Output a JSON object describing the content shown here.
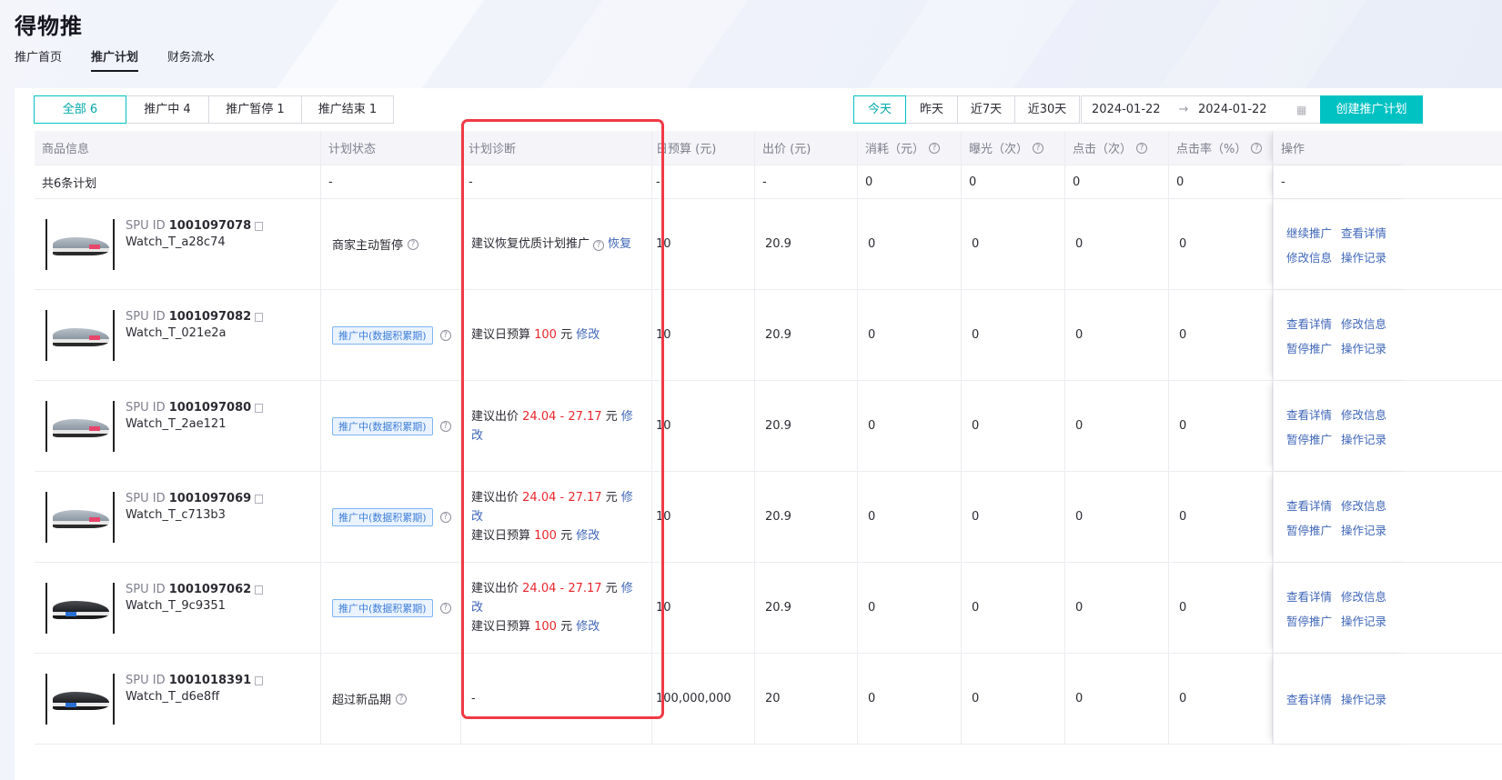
{
  "app": {
    "title": "得物推"
  },
  "nav": {
    "tabs": [
      "推广首页",
      "推广计划",
      "财务流水"
    ],
    "active_index": 1
  },
  "status_filter": {
    "options": [
      "全部 6",
      "推广中 4",
      "推广暂停 1",
      "推广结束 1"
    ],
    "active_index": 0
  },
  "date_filter": {
    "options": [
      "今天",
      "昨天",
      "近7天",
      "近30天"
    ],
    "active_index": 0,
    "start": "2024-01-22",
    "end": "2024-01-22",
    "separator": "→"
  },
  "create_button": "创建推广计划",
  "colors": {
    "accent": "#01c2c3",
    "link": "#3f66b8",
    "emphasis": "#e8262c",
    "highlight_border": "#f03a45"
  },
  "table": {
    "headers": [
      "商品信息",
      "计划状态",
      "计划诊断",
      "日预算 (元)",
      "出价 (元)",
      "消耗（元）",
      "曝光（次）",
      "点击（次）",
      "点击率（%）",
      "操作"
    ],
    "summary": [
      "共6条计划",
      "-",
      "-",
      "-",
      "-",
      "0",
      "0",
      "0",
      "0",
      "-"
    ],
    "rows": [
      {
        "spu_label": "SPU ID",
        "spu": "1001097078",
        "sku": "Watch_T_a28c74",
        "shoe": "gray",
        "status_text": "商家主动暂停",
        "diag": {
          "line1_pre": "建议恢复优质计划推广",
          "line1_link": "恢复"
        },
        "budget": "10",
        "bid": "20.9",
        "cost": "0",
        "exposure": "0",
        "clicks": "0",
        "ctr": "0",
        "ops": [
          "继续推广",
          "查看详情",
          "修改信息",
          "操作记录"
        ]
      },
      {
        "spu_label": "SPU ID",
        "spu": "1001097082",
        "sku": "Watch_T_021e2a",
        "shoe": "gray",
        "status_tag": "推广中(数据积累期)",
        "diag": {
          "line1_pre": "建议日预算 ",
          "line1_red": "100",
          "line1_post": " 元 ",
          "line1_link": "修改"
        },
        "budget": "10",
        "bid": "20.9",
        "cost": "0",
        "exposure": "0",
        "clicks": "0",
        "ctr": "0",
        "ops": [
          "查看详情",
          "修改信息",
          "暂停推广",
          "操作记录"
        ]
      },
      {
        "spu_label": "SPU ID",
        "spu": "1001097080",
        "sku": "Watch_T_2ae121",
        "shoe": "gray",
        "status_tag": "推广中(数据积累期)",
        "diag": {
          "line1_pre": "建议出价 ",
          "line1_red": "24.04 - 27.17",
          "line1_post": " 元 ",
          "line1_link": "修改"
        },
        "budget": "10",
        "bid": "20.9",
        "cost": "0",
        "exposure": "0",
        "clicks": "0",
        "ctr": "0",
        "ops": [
          "查看详情",
          "修改信息",
          "暂停推广",
          "操作记录"
        ]
      },
      {
        "spu_label": "SPU ID",
        "spu": "1001097069",
        "sku": "Watch_T_c713b3",
        "shoe": "gray",
        "status_tag": "推广中(数据积累期)",
        "diag": {
          "line1_pre": "建议出价 ",
          "line1_red": "24.04 - 27.17",
          "line1_post": " 元 ",
          "line1_link": "修改",
          "line2_pre": "建议日预算 ",
          "line2_red": "100",
          "line2_post": " 元 ",
          "line2_link": "修改"
        },
        "budget": "10",
        "bid": "20.9",
        "cost": "0",
        "exposure": "0",
        "clicks": "0",
        "ctr": "0",
        "ops": [
          "查看详情",
          "修改信息",
          "暂停推广",
          "操作记录"
        ]
      },
      {
        "spu_label": "SPU ID",
        "spu": "1001097062",
        "sku": "Watch_T_9c9351",
        "shoe": "black",
        "status_tag": "推广中(数据积累期)",
        "diag": {
          "line1_pre": "建议出价 ",
          "line1_red": "24.04 - 27.17",
          "line1_post": " 元 ",
          "line1_link": "修改",
          "line2_pre": "建议日预算 ",
          "line2_red": "100",
          "line2_post": " 元 ",
          "line2_link": "修改"
        },
        "budget": "10",
        "bid": "20.9",
        "cost": "0",
        "exposure": "0",
        "clicks": "0",
        "ctr": "0",
        "ops": [
          "查看详情",
          "修改信息",
          "暂停推广",
          "操作记录"
        ]
      },
      {
        "spu_label": "SPU ID",
        "spu": "1001018391",
        "sku": "Watch_T_d6e8ff",
        "shoe": "black",
        "status_text": "超过新品期",
        "diag": {
          "line1_pre": "-"
        },
        "budget": "100,000,000",
        "bid": "20",
        "cost": "0",
        "exposure": "0",
        "clicks": "0",
        "ctr": "0",
        "ops": [
          "查看详情",
          "操作记录"
        ]
      }
    ]
  }
}
